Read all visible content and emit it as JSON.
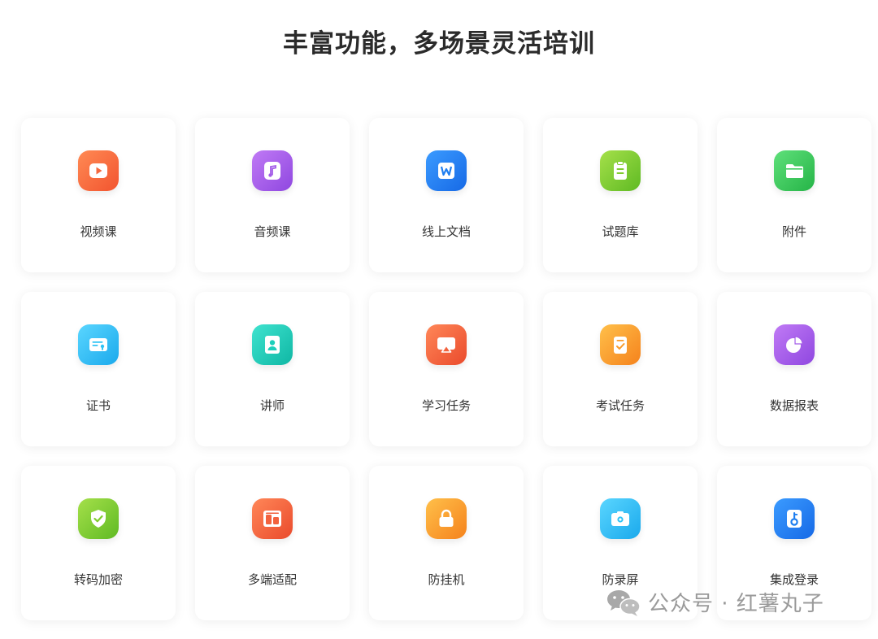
{
  "title": "丰富功能，多场景灵活培训",
  "features": [
    {
      "label": "视频课",
      "icon": "video-play-icon",
      "color": "#f5683e"
    },
    {
      "label": "音频课",
      "icon": "music-note-icon",
      "color": "#a45ce8"
    },
    {
      "label": "线上文档",
      "icon": "word-document-icon",
      "color": "#1e7ef0"
    },
    {
      "label": "试题库",
      "icon": "clipboard-icon",
      "color": "#7fcc2e"
    },
    {
      "label": "附件",
      "icon": "folder-icon",
      "color": "#3dcc5c"
    },
    {
      "label": "证书",
      "icon": "certificate-icon",
      "color": "#2ec3f5"
    },
    {
      "label": "讲师",
      "icon": "instructor-badge-icon",
      "color": "#1ccfbb"
    },
    {
      "label": "学习任务",
      "icon": "screen-cast-icon",
      "color": "#f2623e"
    },
    {
      "label": "考试任务",
      "icon": "exam-check-icon",
      "color": "#f99b2a"
    },
    {
      "label": "数据报表",
      "icon": "pie-chart-icon",
      "color": "#a45ce8"
    },
    {
      "label": "转码加密",
      "icon": "shield-check-icon",
      "color": "#7fcc2e"
    },
    {
      "label": "多端适配",
      "icon": "multi-device-icon",
      "color": "#f2623e"
    },
    {
      "label": "防挂机",
      "icon": "lock-icon",
      "color": "#f99b2a"
    },
    {
      "label": "防录屏",
      "icon": "camera-icon",
      "color": "#2ec3f5"
    },
    {
      "label": "集成登录",
      "icon": "key-icon",
      "color": "#1e7ef0"
    }
  ],
  "watermark": "公众号 · 红薯丸子"
}
